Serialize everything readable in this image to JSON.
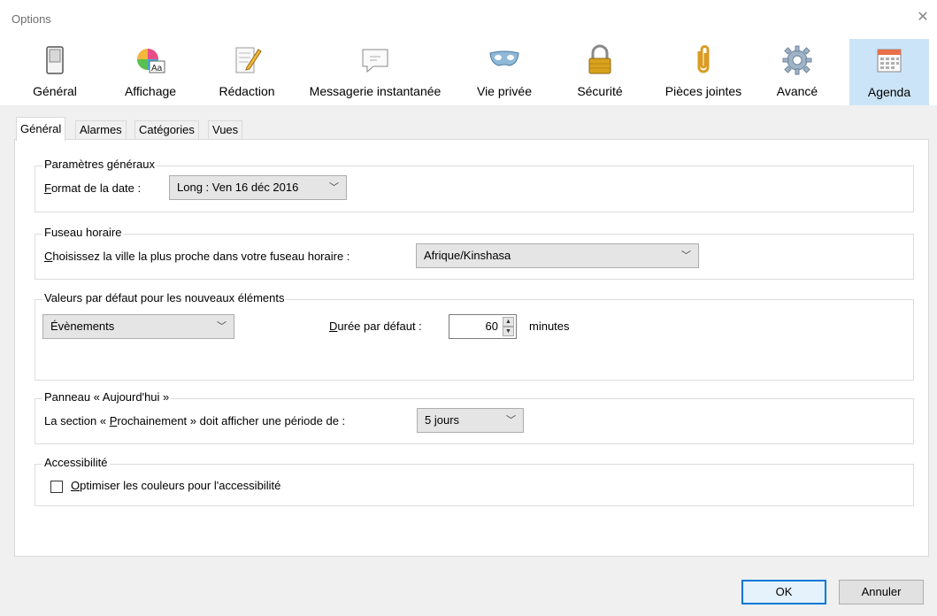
{
  "window": {
    "title": "Options",
    "close_glyph": "✕"
  },
  "toolbar": {
    "items": [
      {
        "label": "Général",
        "icon": "general-switch-icon"
      },
      {
        "label": "Affichage",
        "icon": "display-color-icon"
      },
      {
        "label": "Rédaction",
        "icon": "compose-pencil-icon"
      },
      {
        "label": "Messagerie instantanée",
        "icon": "chat-bubble-icon"
      },
      {
        "label": "Vie privée",
        "icon": "mask-icon"
      },
      {
        "label": "Sécurité",
        "icon": "padlock-icon"
      },
      {
        "label": "Pièces jointes",
        "icon": "paperclip-icon"
      },
      {
        "label": "Avancé",
        "icon": "gear-icon"
      },
      {
        "label": "Agenda",
        "icon": "calendar-icon"
      }
    ],
    "selected": "Agenda",
    "selected_color": "#cce4f7"
  },
  "tabs": [
    "Général",
    "Alarmes",
    "Catégories",
    "Vues"
  ],
  "active_tab": "Général",
  "general_settings": {
    "title": "Paramètres généraux",
    "date_format_label_underlined": "F",
    "date_format_label_rest": "ormat de la date :",
    "date_format_value": "Long : Ven 16 déc 2016"
  },
  "timezone": {
    "title": "Fuseau horaire",
    "label_underlined": "C",
    "label_rest": "hoisissez la ville la plus proche dans votre fuseau horaire :",
    "value": "Afrique/Kinshasa"
  },
  "defaults": {
    "title": "Valeurs par défaut pour les nouveaux éléments",
    "item_type": "Évènements",
    "duration_label_underlined": "D",
    "duration_label_rest": "urée par défaut :",
    "duration_value": "60",
    "duration_unit": "minutes"
  },
  "today_pane": {
    "title": "Panneau « Aujourd'hui »",
    "label_before": "La section « ",
    "label_underlined": "P",
    "label_after": "rochainement » doit afficher une période de :",
    "value": "5 jours"
  },
  "accessibility": {
    "title": "Accessibilité",
    "checkbox_underlined": "O",
    "checkbox_rest": "ptimiser les couleurs pour l'accessibilité",
    "checked": false
  },
  "buttons": {
    "ok": "OK",
    "cancel": "Annuler"
  },
  "chevron": "﹀"
}
